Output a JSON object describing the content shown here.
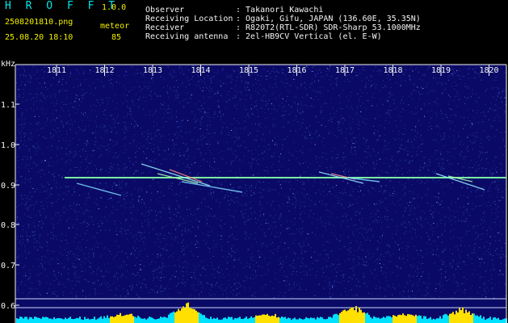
{
  "header": {
    "brand": "H R O F F T",
    "version": "1.0.0",
    "filename": "2508201810.png",
    "datetime": "25.08.20 18:10",
    "detect_label": "meteor",
    "detect_count": "85",
    "info": [
      {
        "label": "Observer",
        "value": ": Takanori Kawachi"
      },
      {
        "label": "Receiving Location",
        "value": ": Ogaki, Gifu, JAPAN (136.60E, 35.35N)"
      },
      {
        "label": "Receiver",
        "value": ": R820T2(RTL-SDR) SDR-Sharp 53.1000MHz"
      },
      {
        "label": "Receiving antenna",
        "value": ": 2el-HB9CV Vertical (el. E-W)"
      }
    ]
  },
  "spectrogram": {
    "y_unit": "kHz",
    "time_ticks": [
      "1811",
      "1812",
      "1813",
      "1814",
      "1815",
      "1816",
      "1817",
      "1818",
      "1819",
      "1820"
    ],
    "freq_ticks": [
      "1.1",
      "1.0",
      "0.9",
      "0.8",
      "0.7",
      "0.6"
    ],
    "colors": {
      "background": "#0a0a66",
      "noise": "#3d55c8",
      "carrier": "#7af0a0",
      "bars": "#00e0ff",
      "peaks": "#ffe000",
      "axis": "#f4f4f4"
    }
  }
}
